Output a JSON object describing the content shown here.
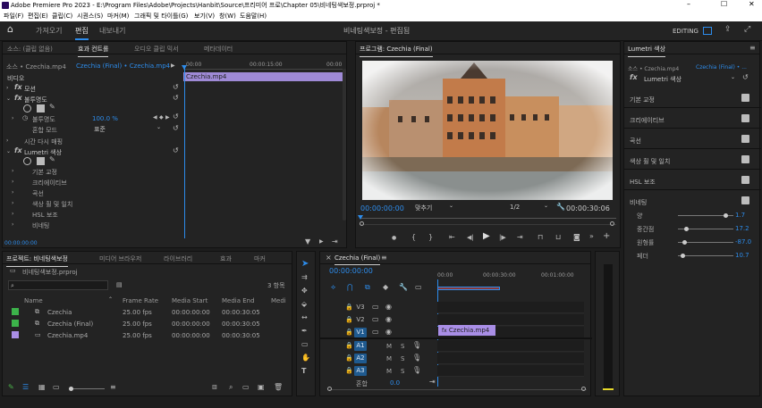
{
  "title_bar": {
    "app_title": "Adobe Premiere Pro 2023 - E:\\Program Files\\Adobe\\Projects\\Hanbit\\Source\\프리미어 프로\\Chapter 05\\비네팅색보정.prproj *",
    "minimize": "–",
    "maximize": "☐",
    "close": "✕"
  },
  "menu": {
    "items": [
      "파일(F)",
      "편집(E)",
      "클립(C)",
      "시퀀스(S)",
      "마커(M)",
      "그래픽 및 타이틀(G)",
      "보기(V)",
      "창(W)",
      "도움말(H)"
    ]
  },
  "workspace": {
    "tabs": [
      "가져오기",
      "편집",
      "내보내기"
    ],
    "title": "비네팅색보정 - 편집됨",
    "mode": "EDITING"
  },
  "effect_controls": {
    "tabs": [
      "소스: (클립 없음)",
      "효과 컨트롤",
      "오디오 클립 믹서",
      "메타데이터"
    ],
    "clip_source": "소스 • Czechia.mp4",
    "clip_target": "Czechia (Final) • Czechia.mp4",
    "ruler": [
      "00:00",
      "00:00:15:00",
      "00:00"
    ],
    "clip_bar": "Czechia.mp4",
    "section_video": "비디오",
    "motion": "모션",
    "opacity": "불투명도",
    "opacity_label": "불투명도",
    "opacity_value": "100.0 %",
    "blend_label": "혼합 모드",
    "blend_value": "표준",
    "time_remap": "시간 다시 매핑",
    "lumetri": "Lumetri 색상",
    "lumetri_items": [
      "기본 교정",
      "크리에이티브",
      "곡선",
      "색상 휠 및 일치",
      "HSL 보조",
      "비네팅"
    ],
    "timecode": "00:00:00:00"
  },
  "program": {
    "tab": "프로그램: Czechia (Final)",
    "timecode": "00:00:00:00",
    "fit": "맞추기",
    "quality": "1/2",
    "duration": "00:00:30:06"
  },
  "lumetri": {
    "tab": "Lumetri 색상",
    "clip_source": "소스 • Czechia.mp4",
    "clip_target": "Czechia (Final) • ...",
    "fx_label": "Lumetri 색상",
    "sections": [
      "기본 교정",
      "크리에이티브",
      "곡선",
      "색상 휠 및 일치",
      "HSL 보조",
      "비네팅"
    ],
    "sliders": [
      {
        "label": "양",
        "value": "1.7",
        "pos": 0.85
      },
      {
        "label": "중간점",
        "value": "17.2",
        "pos": 0.12
      },
      {
        "label": "원형률",
        "value": "-87.0",
        "pos": 0.08
      },
      {
        "label": "페더",
        "value": "10.7",
        "pos": 0.05
      }
    ]
  },
  "project": {
    "tabs": [
      "프로젝트: 비네팅색보정",
      "미디어 브라우저",
      "라이브러리",
      "효과",
      "마커"
    ],
    "file": "비네팅색보정.prproj",
    "count": "3 항목",
    "search_placeholder": "",
    "columns": [
      "Name",
      "Frame Rate",
      "Media Start",
      "Media End",
      "Medi"
    ],
    "rows": [
      {
        "name": "Czechia",
        "rate": "25.00 fps",
        "start": "00:00:00:00",
        "end": "00:00:30:05",
        "color": "#3cb34a"
      },
      {
        "name": "Czechia (Final)",
        "rate": "25.00 fps",
        "start": "00:00:00:00",
        "end": "00:00:30:05",
        "color": "#3cb34a"
      },
      {
        "name": "Czechia.mp4",
        "rate": "25.00 fps",
        "start": "00:00:00:00",
        "end": "00:00:30:05",
        "color": "#a98ee6"
      }
    ]
  },
  "timeline": {
    "tab": "Czechia (Final)",
    "timecode": "00:00:00:00",
    "ruler": [
      "00:00",
      "00:00:30:00",
      "00:01:00:00"
    ],
    "video_tracks": [
      "V3",
      "V2",
      "V1"
    ],
    "audio_tracks": [
      "A1",
      "A2",
      "A3"
    ],
    "mute": "M",
    "solo": "S",
    "clip": "Czechia.mp4",
    "master_label": "혼합",
    "master_value": "0.0"
  },
  "colors": {
    "accent": "#2d8ceb",
    "clip_purple": "#a98ee6",
    "clip_bar": "#9f8ad6"
  }
}
